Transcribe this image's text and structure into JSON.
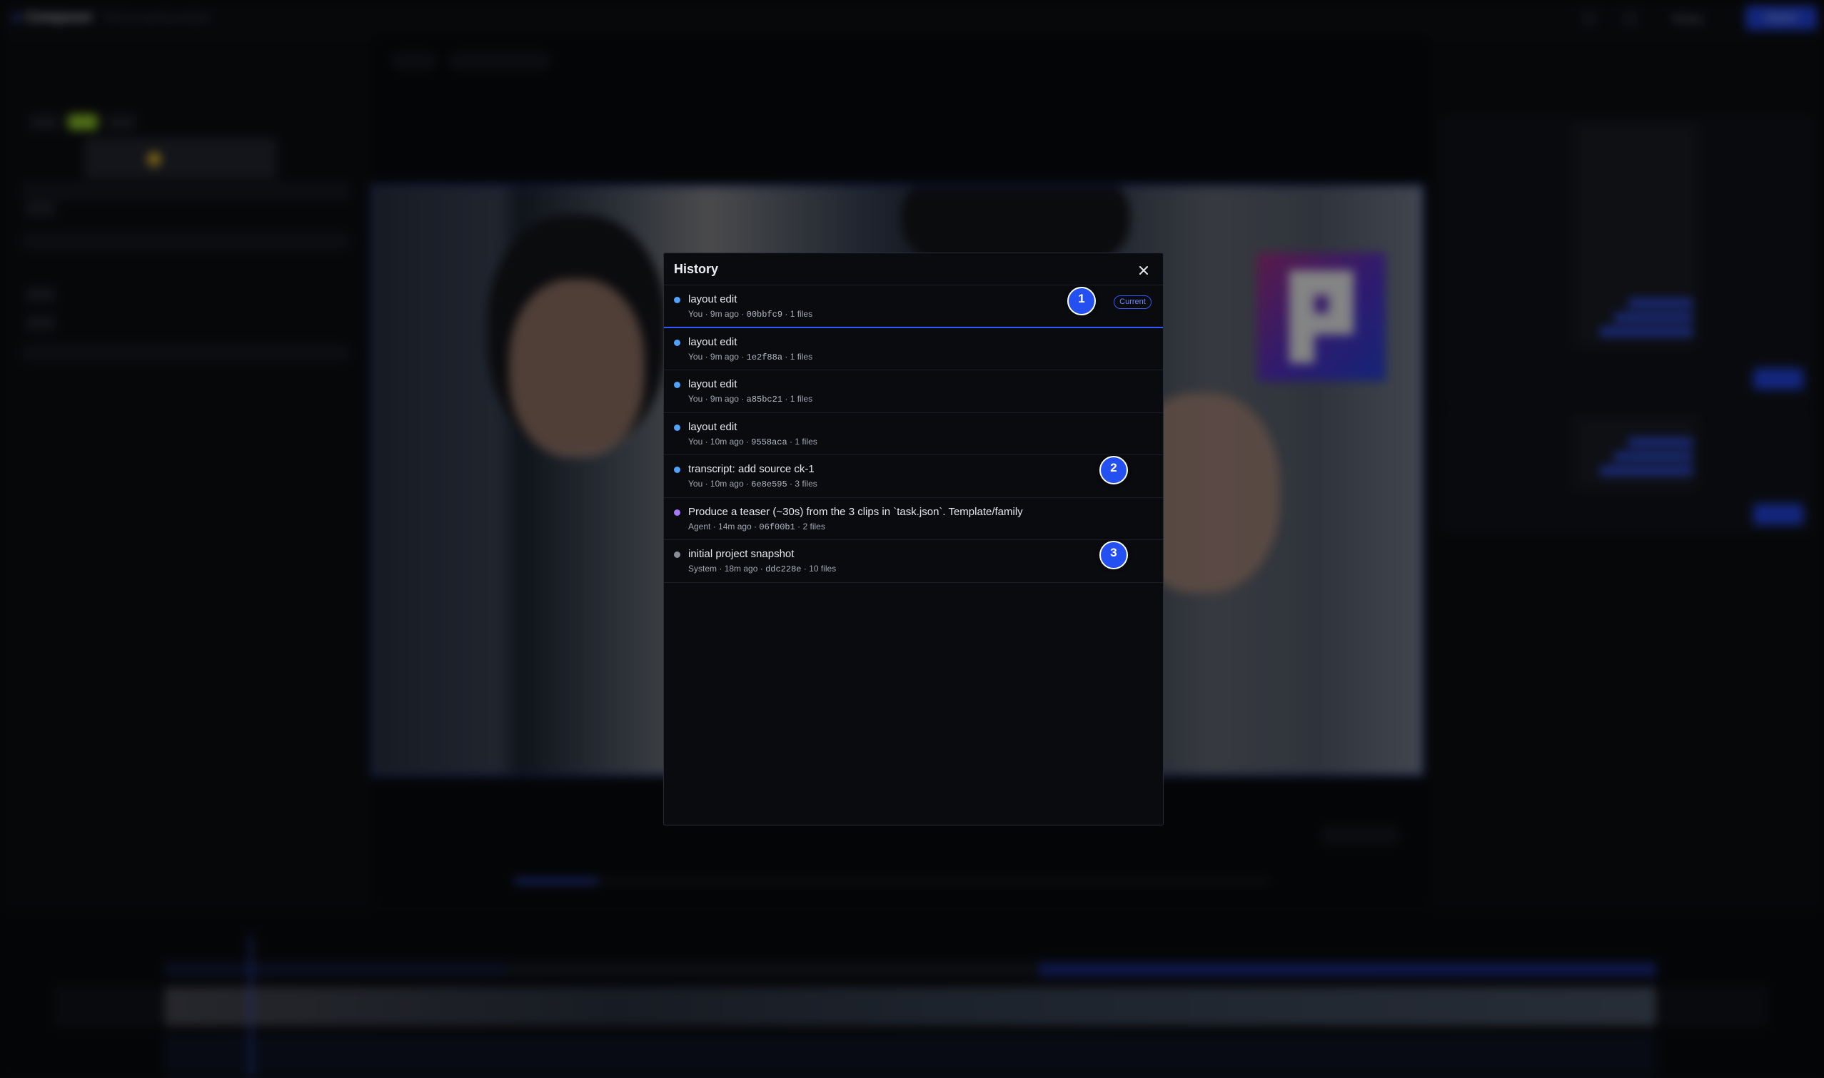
{
  "app": {
    "name": "Composer",
    "search_hint": "Find or search product",
    "history_label": "History",
    "export_label": "Export"
  },
  "colors": {
    "accent": "#3557ff",
    "dot_user": "#4fa3ff",
    "dot_agent": "#a777ff",
    "dot_system": "#8a8e98",
    "marker": "#2450f2"
  },
  "modal": {
    "title": "History",
    "close_icon": "close-icon",
    "entries": [
      {
        "title": "layout edit",
        "author": "You",
        "time": "9m ago",
        "hash": "00bbfc9",
        "files": "1 files",
        "kind": "user",
        "badge": "Current"
      },
      {
        "title": "layout edit",
        "author": "You",
        "time": "9m ago",
        "hash": "1e2f88a",
        "files": "1 files",
        "kind": "user"
      },
      {
        "title": "layout edit",
        "author": "You",
        "time": "9m ago",
        "hash": "a85bc21",
        "files": "1 files",
        "kind": "user"
      },
      {
        "title": "layout edit",
        "author": "You",
        "time": "10m ago",
        "hash": "9558aca",
        "files": "1 files",
        "kind": "user"
      },
      {
        "title": "transcript: add source ck-1",
        "author": "You",
        "time": "10m ago",
        "hash": "6e8e595",
        "files": "3 files",
        "kind": "user"
      },
      {
        "title": "Produce a teaser (~30s) from the 3 clips in `task.json`. Template/family",
        "author": "Agent",
        "time": "14m ago",
        "hash": "06f00b1",
        "files": "2 files",
        "kind": "agent"
      },
      {
        "title": "initial project snapshot",
        "author": "System",
        "time": "18m ago",
        "hash": "ddc228e",
        "files": "10 files",
        "kind": "system"
      }
    ],
    "sep": " · "
  },
  "markers": [
    "1",
    "2",
    "3"
  ]
}
